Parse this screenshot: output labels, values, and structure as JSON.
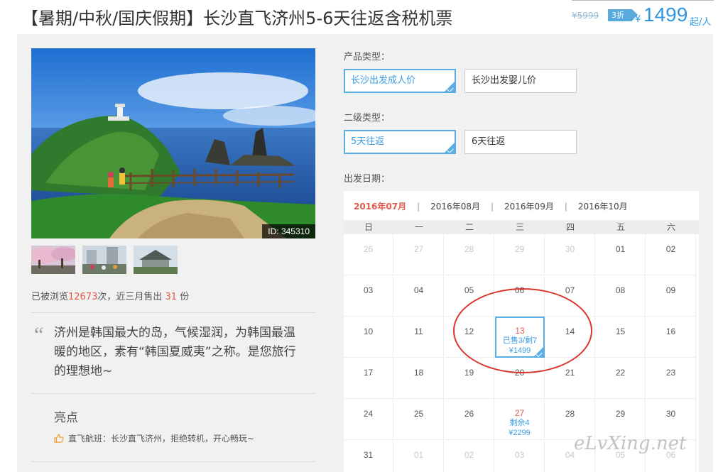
{
  "header": {
    "title": "【暑期/中秋/国庆假期】长沙直飞济州5-6天往返含税机票",
    "original_price": "¥5999",
    "discount": "3折",
    "currency": "¥",
    "price": "1499",
    "unit": "起/人"
  },
  "gallery": {
    "image_id": "ID: 345310",
    "thumbnail_count": 3
  },
  "stats": {
    "prefix": "已被浏览",
    "views": "12673",
    "middle": "次，近三月售出 ",
    "sold": "31",
    "suffix": " 份"
  },
  "description": "济州是韩国最大的岛，气候湿润，为韩国最温暖的地区，素有“韩国夏威夷”之称。是您旅行的理想地~",
  "highlights": {
    "title": "亮点",
    "items": [
      "直飞航班：长沙直飞济州，拒绝转机，开心畅玩~"
    ]
  },
  "product_type": {
    "label": "产品类型：",
    "options": [
      "长沙出发成人价",
      "长沙出发婴儿价"
    ],
    "selected": 0
  },
  "sub_type": {
    "label": "二级类型：",
    "options": [
      "5天往返",
      "6天往返"
    ],
    "selected": 0
  },
  "departure": {
    "label": "出发日期：",
    "months": [
      "2016年07月",
      "2016年08月",
      "2016年09月",
      "2016年10月"
    ],
    "active_month": 0,
    "weekdays": [
      "日",
      "一",
      "二",
      "三",
      "四",
      "五",
      "六"
    ],
    "weeks": [
      [
        {
          "d": "26",
          "o": true
        },
        {
          "d": "27",
          "o": true
        },
        {
          "d": "28",
          "o": true
        },
        {
          "d": "29",
          "o": true
        },
        {
          "d": "30",
          "o": true
        },
        {
          "d": "01"
        },
        {
          "d": "02"
        }
      ],
      [
        {
          "d": "03"
        },
        {
          "d": "04"
        },
        {
          "d": "05"
        },
        {
          "d": "06"
        },
        {
          "d": "07"
        },
        {
          "d": "08"
        },
        {
          "d": "09"
        }
      ],
      [
        {
          "d": "10"
        },
        {
          "d": "11"
        },
        {
          "d": "12"
        },
        {
          "d": "13",
          "s1": "已售3/剩7",
          "s2": "¥1499",
          "picked": true
        },
        {
          "d": "14"
        },
        {
          "d": "15"
        },
        {
          "d": "16"
        }
      ],
      [
        {
          "d": "17"
        },
        {
          "d": "18"
        },
        {
          "d": "19"
        },
        {
          "d": "20"
        },
        {
          "d": "21"
        },
        {
          "d": "22"
        },
        {
          "d": "23"
        }
      ],
      [
        {
          "d": "24"
        },
        {
          "d": "25"
        },
        {
          "d": "26"
        },
        {
          "d": "27",
          "s1": "剩余4",
          "s2": "¥2299"
        },
        {
          "d": "28"
        },
        {
          "d": "29"
        },
        {
          "d": "30"
        }
      ],
      [
        {
          "d": "31"
        },
        {
          "d": "01",
          "o": true
        },
        {
          "d": "02",
          "o": true
        },
        {
          "d": "03",
          "o": true
        },
        {
          "d": "04",
          "o": true
        },
        {
          "d": "05",
          "o": true
        },
        {
          "d": "06",
          "o": true
        }
      ]
    ]
  },
  "watermark": "eLvXing.net",
  "colors": {
    "accent": "#2f97e0",
    "highlight": "#e05b4b",
    "annotation": "#d9342c"
  }
}
